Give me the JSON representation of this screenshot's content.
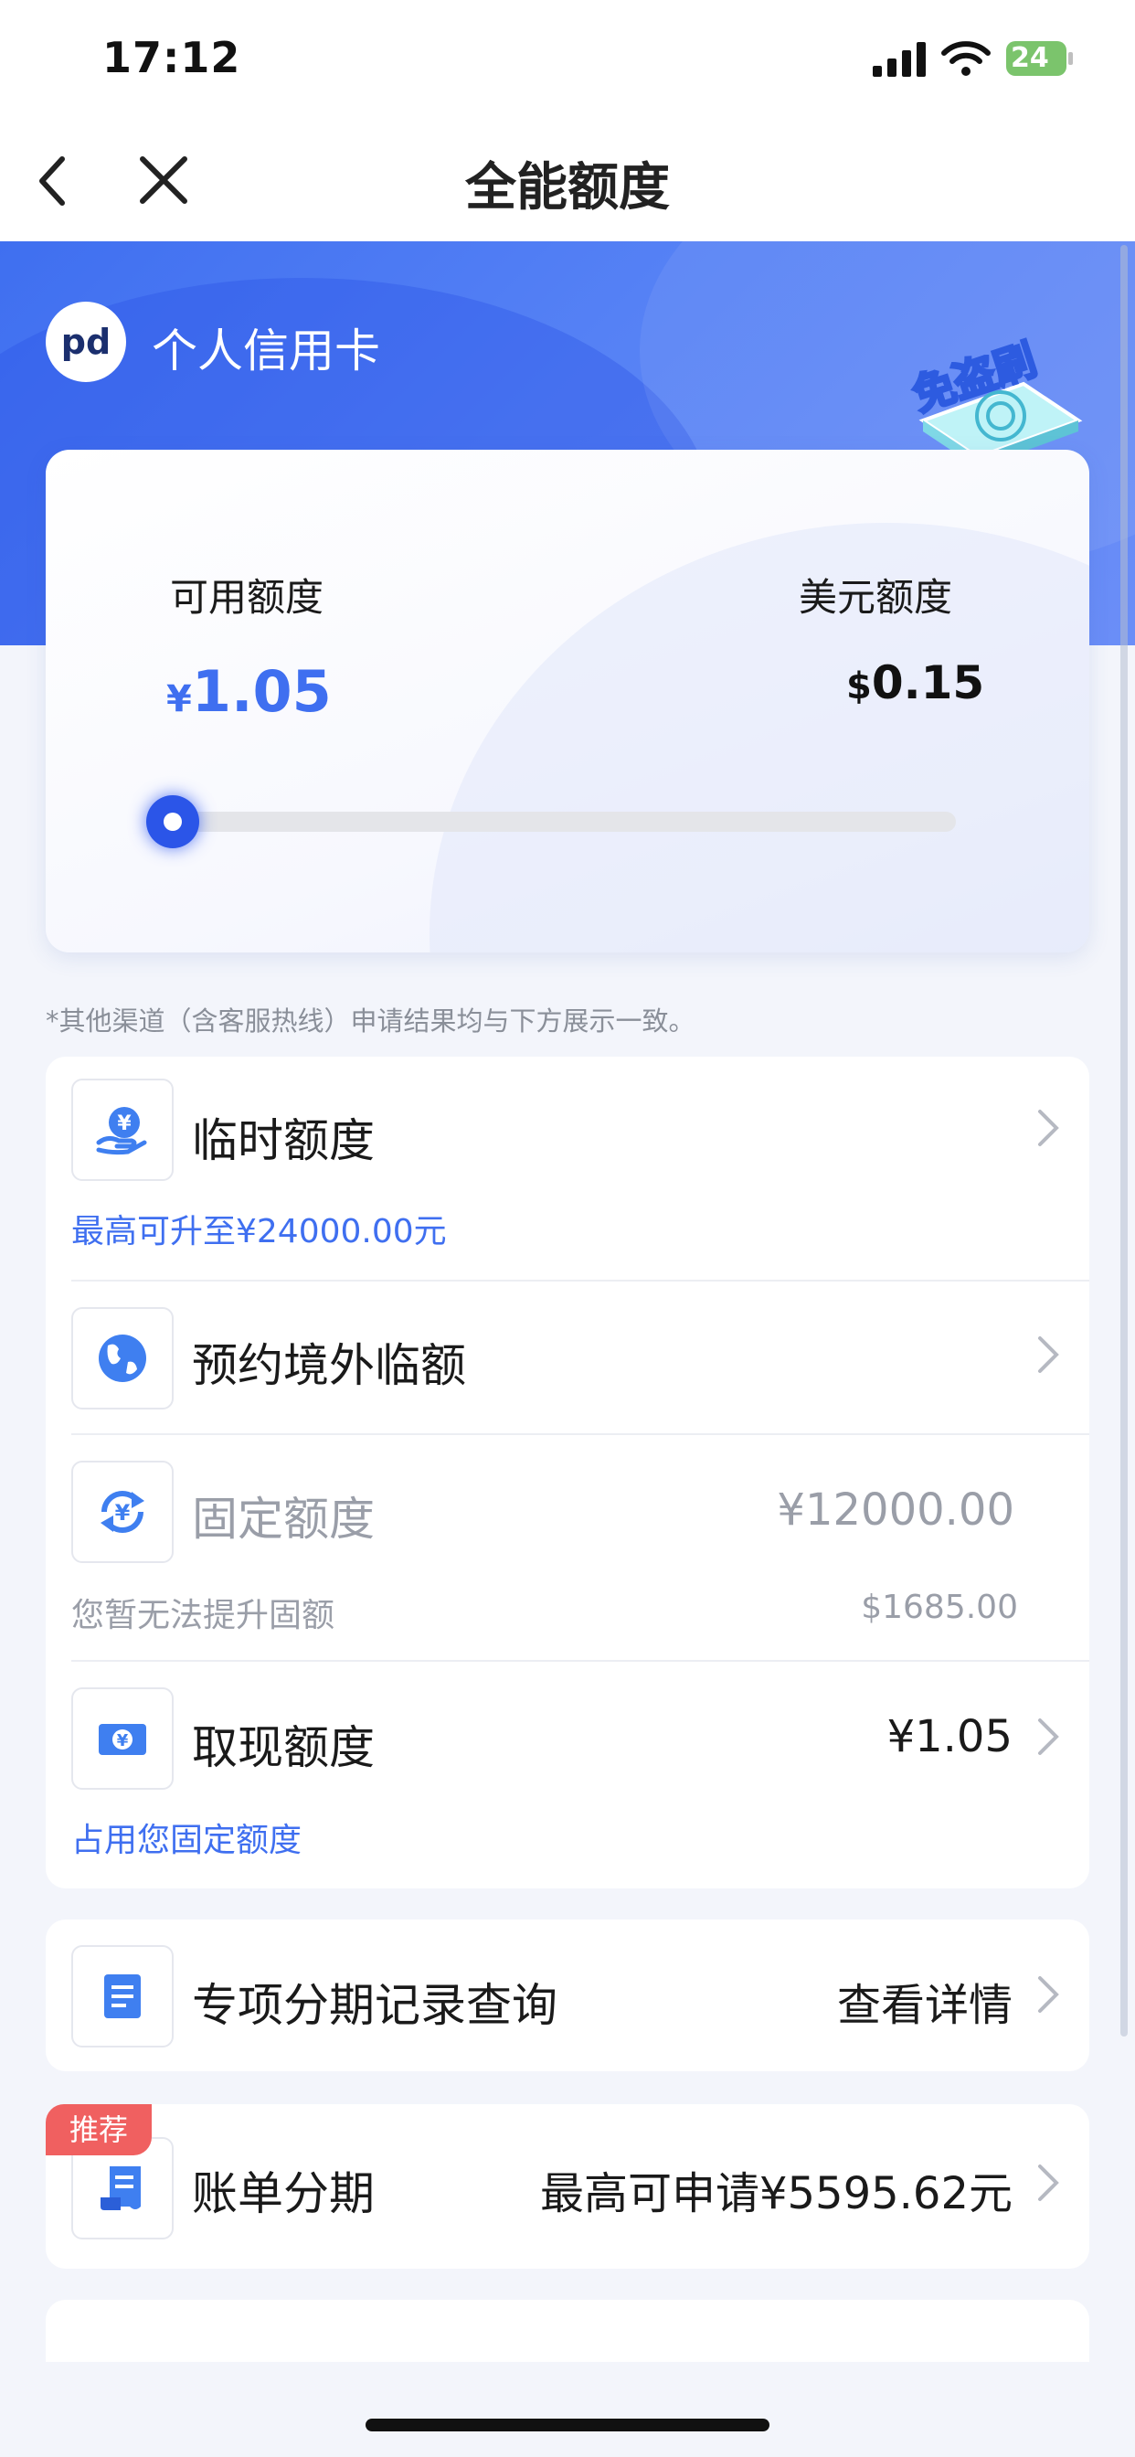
{
  "status_bar": {
    "time": "17:12",
    "battery": "24",
    "icons": [
      "signal-icon",
      "wifi-icon",
      "battery-charging-icon"
    ]
  },
  "nav": {
    "title": "全能额度",
    "back_icon": "chevron-left-icon",
    "close_icon": "close-icon"
  },
  "header": {
    "card_type": "个人信用卡",
    "bank_logo_icon": "bank-logo-icon",
    "badge": "免盗刷"
  },
  "credit": {
    "available_label": "可用额度",
    "available_currency": "¥",
    "available_amount": "1.05",
    "usd_label": "美元额度",
    "usd_currency": "$",
    "usd_amount": "0.15",
    "progress_fraction": 0.0
  },
  "disclaimer": "*其他渠道（含客服热线）申请结果均与下方展示一致。",
  "rows": [
    {
      "title": "临时额度",
      "sub": "最高可升至¥24000.00元",
      "icon": "yuan-hand-icon"
    },
    {
      "title": "预约境外临额",
      "icon": "globe-icon"
    },
    {
      "title": "固定额度",
      "value": "¥12000.00",
      "sub": "您暂无法提升固额",
      "sub_value": "$1685.00",
      "icon": "yuan-refresh-icon"
    },
    {
      "title": "取现额度",
      "value": "¥1.05",
      "sub": "占用您固定额度",
      "icon": "cash-icon"
    }
  ],
  "installment_record": {
    "title": "专项分期记录查询",
    "action": "查看详情",
    "icon": "document-list-icon"
  },
  "bill_installment": {
    "badge": "推荐",
    "title": "账单分期",
    "value": "最高可申请¥5595.62元",
    "icon": "receipt-icon"
  },
  "colors": {
    "accent": "#3f6ff0",
    "badge_red": "#f06060",
    "muted": "#9a9ea8"
  }
}
